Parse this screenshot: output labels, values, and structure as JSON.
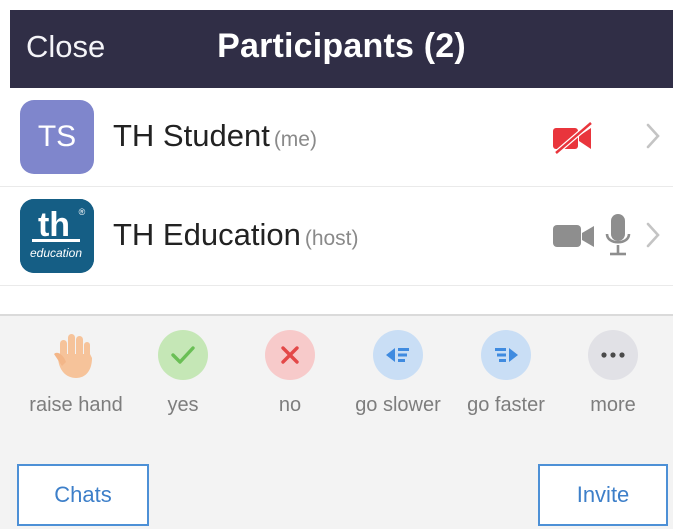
{
  "header": {
    "close_label": "Close",
    "title": "Participants (2)",
    "bg_color": "#302e46"
  },
  "participants": [
    {
      "initials": "TS",
      "name": "TH Student",
      "tag": "(me)",
      "avatar_color": "#7f86cc",
      "video": "video-off-icon",
      "video_color": "#e9353c"
    },
    {
      "logo_text_top": "th",
      "logo_text_bottom": "education",
      "logo_mark": "®",
      "name": "TH Education",
      "tag": "(host)",
      "avatar_color": "#155e85",
      "video": "video-camera-icon",
      "audio": "microphone-icon",
      "icon_color": "#8e8e8e"
    }
  ],
  "reactions": [
    {
      "label": "raise hand",
      "icon": "raise-hand-icon"
    },
    {
      "label": "yes",
      "icon": "checkmark-icon",
      "color": "#6abf55"
    },
    {
      "label": "no",
      "icon": "x-icon",
      "color": "#e34848"
    },
    {
      "label": "go slower",
      "icon": "go-slower-icon",
      "color": "#3f8be0"
    },
    {
      "label": "go faster",
      "icon": "go-faster-icon",
      "color": "#3f8be0"
    },
    {
      "label": "more",
      "icon": "more-dots-icon",
      "color": "#4a4a4a"
    }
  ],
  "buttons": {
    "chats": "Chats",
    "invite": "Invite"
  }
}
